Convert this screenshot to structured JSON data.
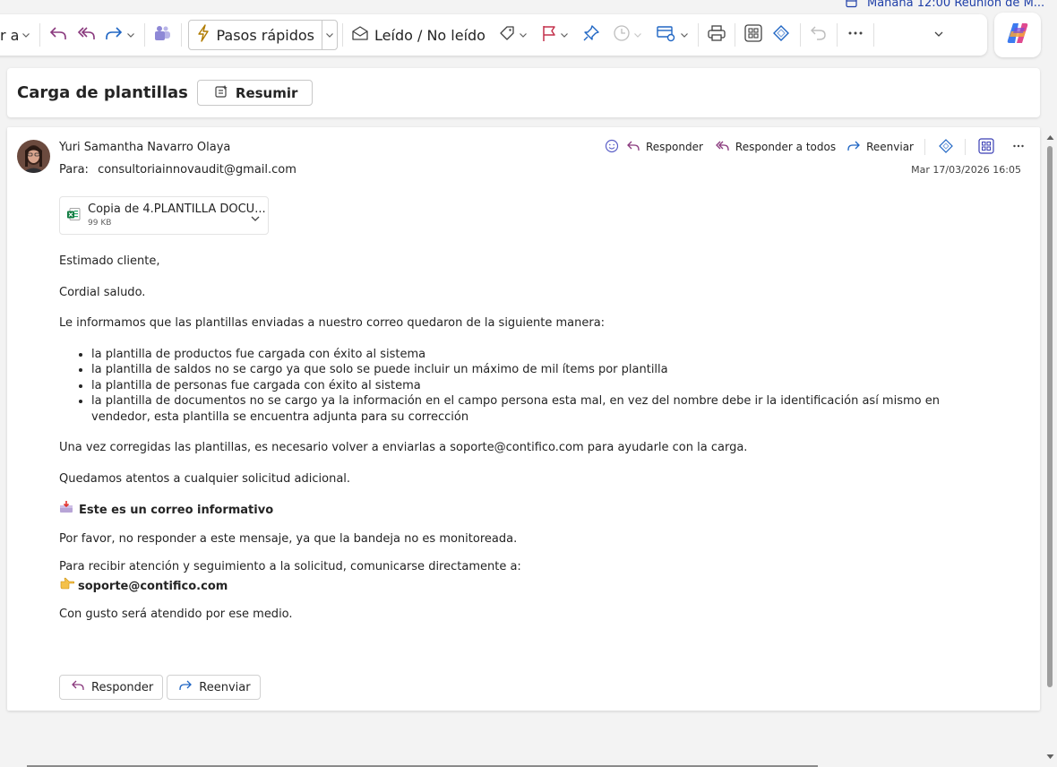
{
  "reminder": {
    "text": "Mañana 12:00 Reunión de M..."
  },
  "toolbar": {
    "cut_label": "r a",
    "quick_steps": "Pasos rápidos",
    "read_unread": "Leído / No leído"
  },
  "subject": {
    "title": "Carga de plantillas",
    "summarize": "Resumir"
  },
  "message": {
    "sender": "Yuri Samantha Navarro Olaya",
    "to_label": "Para:",
    "to_value": "consultoriainnovaudit@gmail.com",
    "date": "Mar 17/03/2026 16:05",
    "actions": {
      "reply": "Responder",
      "reply_all": "Responder a todos",
      "forward": "Reenviar"
    },
    "attachment": {
      "name": "Copia de 4.PLANTILLA DOCU...",
      "size": "99 KB"
    },
    "body": {
      "greeting": "Estimado cliente,",
      "salute": "Cordial saludo.",
      "intro": "Le informamos que las plantillas enviadas a nuestro correo quedaron de la siguiente manera:",
      "items": [
        "la plantilla de productos fue cargada con éxito al sistema",
        "la plantilla de saldos no se cargo ya que solo se puede incluir un máximo de mil ítems por plantilla",
        "la plantilla de personas fue cargada con éxito al sistema",
        "la plantilla de documentos no se cargo ya la información en el campo persona esta mal, en vez del nombre debe ir la identificación así mismo en vendedor, esta plantilla se encuentra adjunta para su corrección"
      ],
      "resend": "Una vez corregidas las plantillas, es necesario volver a enviarlas a soporte@contifico.com para ayudarle con la carga.",
      "pending": "Quedamos atentos a cualquier solicitud adicional.",
      "info_heading": "Este es un correo informativo",
      "no_reply": "Por favor, no responder a este mensaje, ya que la bandeja no es monitoreada.",
      "contact_intro": "Para recibir atención y seguimiento a la solicitud, comunicarse directamente a:",
      "contact_email": "soporte@contifico.com",
      "closing": "Con gusto será atendido por ese medio."
    },
    "bottom": {
      "reply": "Responder",
      "forward": "Reenviar"
    }
  }
}
